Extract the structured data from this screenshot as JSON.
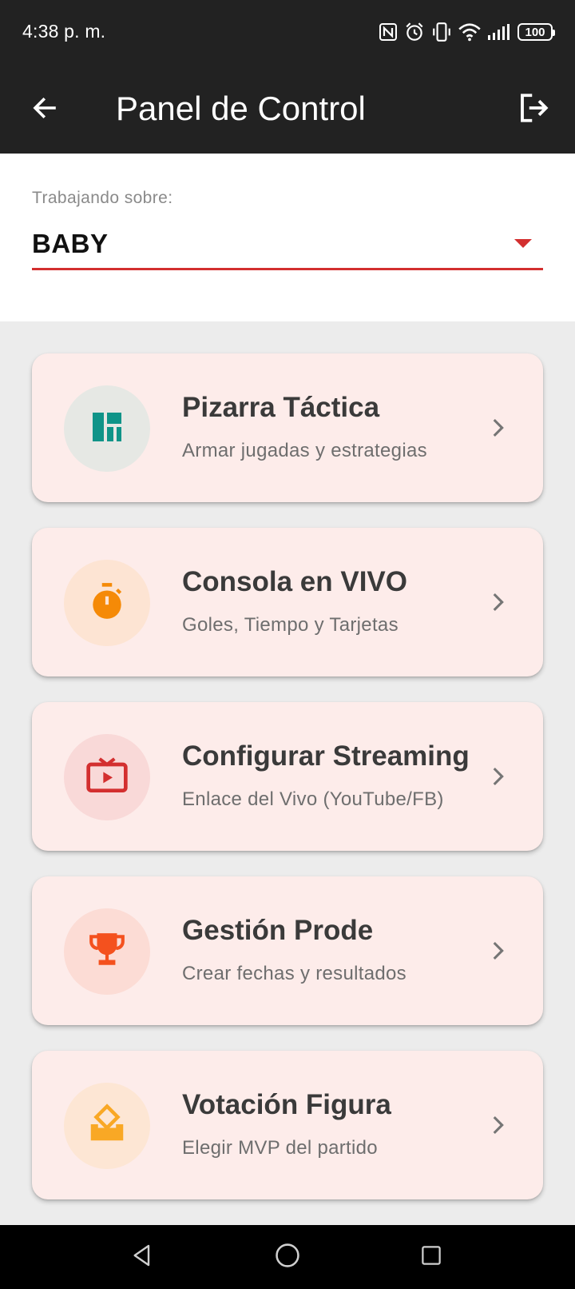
{
  "status_bar": {
    "time": "4:38 p. m.",
    "battery_level": "100",
    "icons": [
      "nfc-icon",
      "alarm-icon",
      "vibrate-icon",
      "wifi-icon",
      "signal-icon",
      "battery-icon"
    ]
  },
  "app_bar": {
    "title": "Panel de Control",
    "back_icon": "arrow-left-icon",
    "logout_icon": "logout-icon"
  },
  "selector": {
    "label": "Trabajando sobre:",
    "value": "BABY",
    "accent_color": "#d32f2f"
  },
  "menu": {
    "items": [
      {
        "title": "Pizarra Táctica",
        "subtitle": "Armar jugadas y estrategias",
        "icon": "dashboard-icon",
        "icon_color": "#0f9488",
        "circle_color": "#e6e8e4"
      },
      {
        "title": "Consola en VIVO",
        "subtitle": "Goles, Tiempo y Tarjetas",
        "icon": "timer-icon",
        "icon_color": "#f58a07",
        "circle_color": "#fde4d3"
      },
      {
        "title": "Configurar Streaming",
        "subtitle": "Enlace del Vivo (YouTube/FB)",
        "icon": "live-tv-icon",
        "icon_color": "#d32f2f",
        "circle_color": "#f9d9d8"
      },
      {
        "title": "Gestión Prode",
        "subtitle": "Crear fechas y resultados",
        "icon": "trophy-icon",
        "icon_color": "#f4511e",
        "circle_color": "#fcdcd5"
      },
      {
        "title": "Votación Figura",
        "subtitle": "Elegir MVP del partido",
        "icon": "vote-icon",
        "icon_color": "#f9a825",
        "circle_color": "#fde6d4"
      }
    ]
  },
  "colors": {
    "app_bar": "#222222",
    "card_background": "#fdecea",
    "page_background": "#ececec"
  },
  "nav_bar": {
    "icons": [
      "nav-back-icon",
      "nav-home-icon",
      "nav-recents-icon"
    ]
  }
}
